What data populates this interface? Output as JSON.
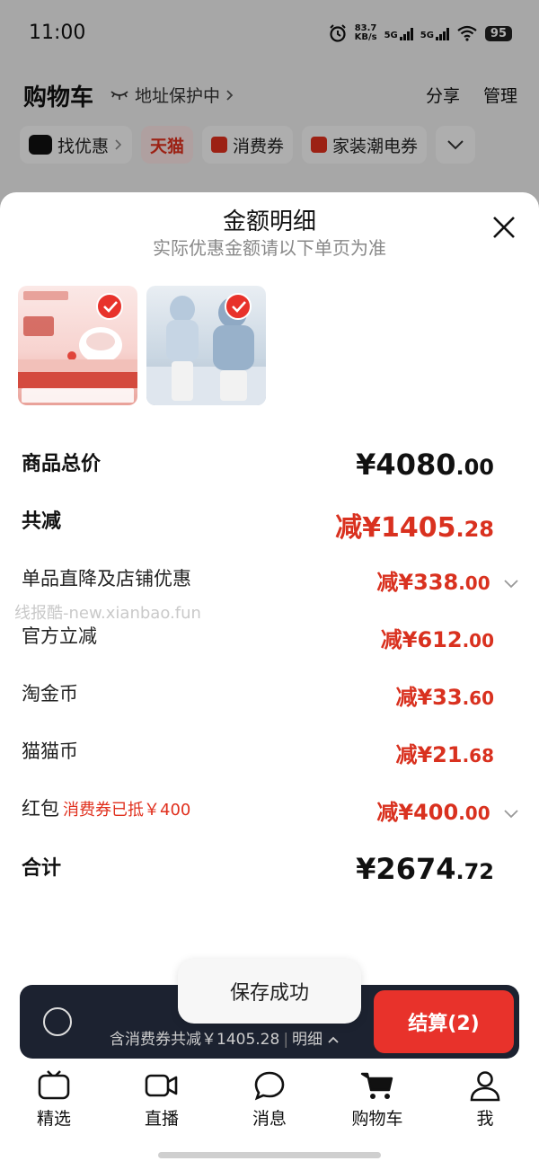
{
  "status_bar": {
    "time": "11:00",
    "net_speed_value": "83.7",
    "net_speed_unit": "KB/s",
    "sim1": "5G",
    "sim2": "5G",
    "battery": "95"
  },
  "cart_header": {
    "title": "购物车",
    "address_protect": "地址保护中",
    "share": "分享",
    "manage": "管理"
  },
  "chips": [
    {
      "label": "找优惠"
    },
    {
      "label": "天猫"
    },
    {
      "label": "消费券"
    },
    {
      "label": "家装潮电券"
    }
  ],
  "sheet": {
    "title": "金额明细",
    "subtitle": "实际优惠金额请以下单页为准",
    "thumbs": [
      {
        "name": "product-thumb-breast-pump",
        "selected": true
      },
      {
        "name": "product-thumb-down-jacket",
        "selected": true
      }
    ],
    "rows": {
      "total_price": {
        "label": "商品总价",
        "currency": "¥",
        "int": "4080",
        "dec": ".00"
      },
      "total_discount": {
        "label": "共减",
        "prefix": "减¥",
        "int": "1405",
        "dec": ".28"
      },
      "item_store": {
        "label": "单品直降及店铺优惠",
        "prefix": "减¥",
        "int": "338",
        "dec": ".00"
      },
      "official": {
        "label": "官方立减",
        "prefix": "减¥",
        "int": "612",
        "dec": ".00"
      },
      "taojinbi": {
        "label": "淘金币",
        "prefix": "减¥",
        "int": "33",
        "dec": ".60"
      },
      "maomaobi": {
        "label": "猫猫币",
        "prefix": "减¥",
        "int": "21",
        "dec": ".68"
      },
      "hongbao": {
        "label": "红包",
        "sub": "消费券已抵￥400",
        "prefix": "减¥",
        "int": "400",
        "dec": ".00"
      },
      "sum": {
        "label": "合计",
        "currency": "¥",
        "int": "2674",
        "dec": ".72"
      }
    }
  },
  "watermark": "线报酷-new.xianbao.fun",
  "checkout": {
    "note": "含消费券共减￥1405.28",
    "detail": "明细",
    "pay_label": "结算(2)"
  },
  "toast": "保存成功",
  "tabbar": [
    {
      "label": "精选",
      "icon": "tv-icon"
    },
    {
      "label": "直播",
      "icon": "video-camera-icon"
    },
    {
      "label": "消息",
      "icon": "chat-bubble-icon"
    },
    {
      "label": "购物车",
      "icon": "shopping-cart-icon"
    },
    {
      "label": "我",
      "icon": "person-icon"
    }
  ]
}
